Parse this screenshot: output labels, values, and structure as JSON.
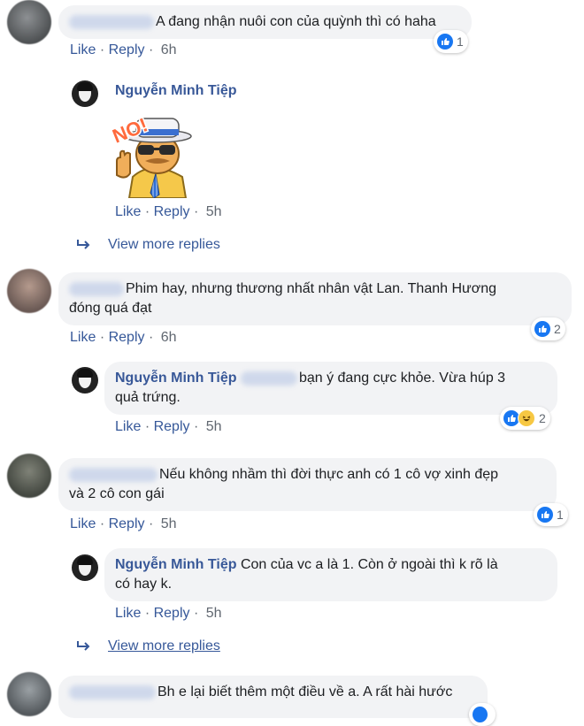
{
  "actions": {
    "like": "Like",
    "reply": "Reply",
    "sep": "·"
  },
  "comments": [
    {
      "author_blurred": true,
      "text": "A đang nhận nuôi con của quỳnh thì có haha",
      "time": "6h",
      "reactions": {
        "count": "1",
        "types": [
          "like"
        ]
      }
    },
    {
      "author": "Nguyễn Minh Tiệp",
      "sticker": "no-man-sticker",
      "sticker_text": "NO!",
      "time": "5h"
    },
    {
      "view_more": "View more replies"
    },
    {
      "author_blurred": true,
      "text_line1": "Phim hay, nhưng thương nhất nhân vật Lan. Thanh Hương",
      "text_line2": "đóng quá đạt",
      "time": "6h",
      "reactions": {
        "count": "2",
        "types": [
          "like"
        ]
      }
    },
    {
      "author": "Nguyễn Minh Tiệp",
      "text_line1": "bạn ý đang cực khỏe. Vừa húp 3",
      "text_line2": "quả trứng.",
      "time": "5h",
      "reactions": {
        "count": "2",
        "types": [
          "like",
          "haha"
        ]
      }
    },
    {
      "author_blurred": true,
      "text_line1": "Nếu không nhầm thì đời thực anh có 1 cô vợ xinh đẹp",
      "text_line2": "và 2 cô con gái",
      "time": "5h",
      "reactions": {
        "count": "1",
        "types": [
          "like"
        ]
      }
    },
    {
      "author": "Nguyễn Minh Tiệp",
      "text_line1": "Con của vc a là 1. Còn ở ngoài thì k rõ là",
      "text_line2": "có hay k.",
      "time": "5h"
    },
    {
      "view_more": "View more replies"
    },
    {
      "author_blurred": true,
      "text": "Bh e lại biết thêm một điều về a. A rất hài hước"
    }
  ],
  "colors": {
    "link": "#365899",
    "author": "#385898",
    "bubble": "#f2f3f5",
    "like_blue": "#1877f2"
  }
}
